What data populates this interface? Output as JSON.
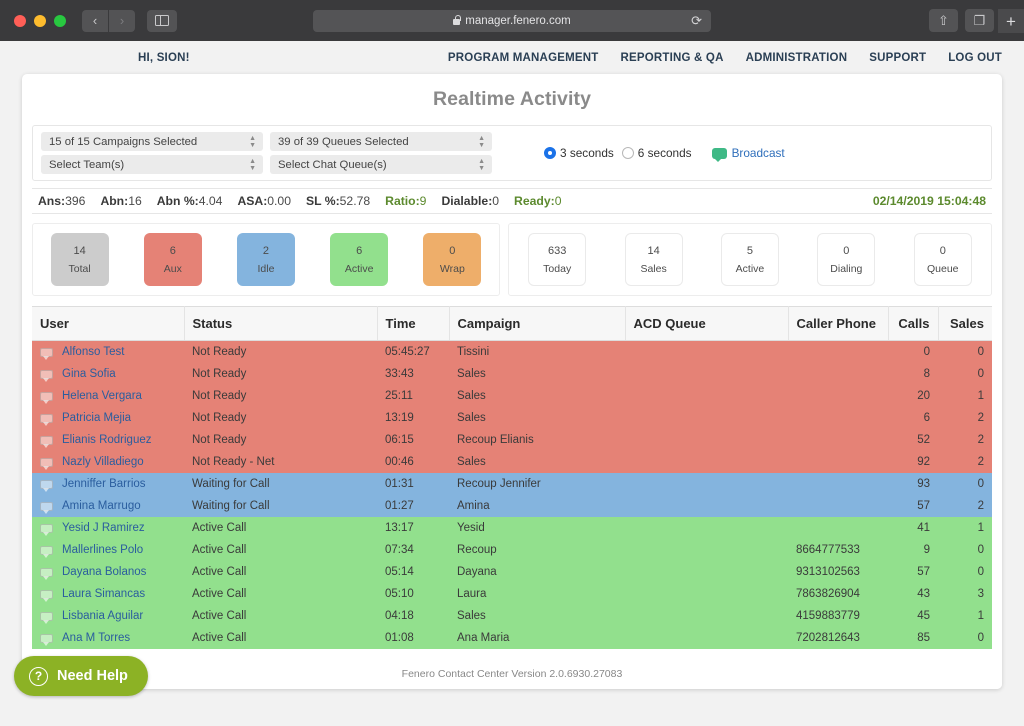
{
  "browser": {
    "url": "manager.fenero.com",
    "back_icon": "chevron-left-icon",
    "forward_icon": "chevron-right-icon",
    "sidebar_icon": "sidebar-toggle-icon",
    "reload_icon": "reload-icon",
    "share_icon": "share-icon",
    "tabs_icon": "show-tabs-icon",
    "new_tab_icon": "plus-icon"
  },
  "app_nav": {
    "greeting": "HI, SION!",
    "links": [
      "PROGRAM MANAGEMENT",
      "REPORTING & QA",
      "ADMINISTRATION",
      "SUPPORT",
      "LOG OUT"
    ]
  },
  "page": {
    "title": "Realtime Activity",
    "version": "Fenero Contact Center Version 2.0.6930.27083",
    "need_help": "Need Help"
  },
  "filters": {
    "campaigns": "15 of 15 Campaigns Selected",
    "queues": "39 of 39 Queues Selected",
    "teams": "Select Team(s)",
    "chat_queues": "Select Chat Queue(s)",
    "refresh": [
      {
        "label": "3 seconds",
        "selected": true
      },
      {
        "label": "6 seconds",
        "selected": false
      }
    ],
    "broadcast": "Broadcast"
  },
  "stats": [
    {
      "key": "Ans:",
      "value": "396",
      "green": false
    },
    {
      "key": "Abn:",
      "value": "16",
      "green": false
    },
    {
      "key": "Abn %:",
      "value": "4.04",
      "green": false
    },
    {
      "key": "ASA:",
      "value": "0.00",
      "green": false
    },
    {
      "key": "SL %:",
      "value": "52.78",
      "green": false
    },
    {
      "key": "Ratio:",
      "value": "9",
      "green": true
    },
    {
      "key": "Dialable:",
      "value": "0",
      "green": false
    },
    {
      "key": "Ready:",
      "value": "0",
      "green": true
    }
  ],
  "clock": "02/14/2019 15:04:48",
  "agent_tiles": [
    {
      "num": "14",
      "label": "Total",
      "color": "gray"
    },
    {
      "num": "6",
      "label": "Aux",
      "color": "red"
    },
    {
      "num": "2",
      "label": "Idle",
      "color": "blue"
    },
    {
      "num": "6",
      "label": "Active",
      "color": "green"
    },
    {
      "num": "0",
      "label": "Wrap",
      "color": "orange"
    }
  ],
  "call_tiles": [
    {
      "num": "633",
      "label": "Today",
      "color": "plain"
    },
    {
      "num": "14",
      "label": "Sales",
      "color": "plain"
    },
    {
      "num": "5",
      "label": "Active",
      "color": "plain"
    },
    {
      "num": "0",
      "label": "Dialing",
      "color": "plain"
    },
    {
      "num": "0",
      "label": "Queue",
      "color": "plain"
    }
  ],
  "table": {
    "columns": [
      "User",
      "Status",
      "Time",
      "Campaign",
      "ACD Queue",
      "Caller Phone",
      "Calls",
      "Sales"
    ],
    "rows": [
      {
        "state": "notready",
        "user": "Alfonso Test",
        "status": "Not Ready",
        "time": "05:45:27",
        "campaign": "Tissini",
        "acd_queue": "",
        "caller_phone": "",
        "calls": "0",
        "sales": "0"
      },
      {
        "state": "notready",
        "user": "Gina Sofia",
        "status": "Not Ready",
        "time": "33:43",
        "campaign": "Sales",
        "acd_queue": "",
        "caller_phone": "",
        "calls": "8",
        "sales": "0"
      },
      {
        "state": "notready",
        "user": "Helena Vergara",
        "status": "Not Ready",
        "time": "25:11",
        "campaign": "Sales",
        "acd_queue": "",
        "caller_phone": "",
        "calls": "20",
        "sales": "1"
      },
      {
        "state": "notready",
        "user": "Patricia Mejia",
        "status": "Not Ready",
        "time": "13:19",
        "campaign": "Sales",
        "acd_queue": "",
        "caller_phone": "",
        "calls": "6",
        "sales": "2"
      },
      {
        "state": "notready",
        "user": "Elianis Rodriguez",
        "status": "Not Ready",
        "time": "06:15",
        "campaign": "Recoup Elianis",
        "acd_queue": "",
        "caller_phone": "",
        "calls": "52",
        "sales": "2"
      },
      {
        "state": "notready",
        "user": "Nazly Villadiego",
        "status": "Not Ready - Net",
        "time": "00:46",
        "campaign": "Sales",
        "acd_queue": "",
        "caller_phone": "",
        "calls": "92",
        "sales": "2"
      },
      {
        "state": "waiting",
        "user": "Jenniffer Barrios",
        "status": "Waiting for Call",
        "time": "01:31",
        "campaign": "Recoup Jennifer",
        "acd_queue": "",
        "caller_phone": "",
        "calls": "93",
        "sales": "0"
      },
      {
        "state": "waiting",
        "user": "Amina Marrugo",
        "status": "Waiting for Call",
        "time": "01:27",
        "campaign": "Amina",
        "acd_queue": "",
        "caller_phone": "",
        "calls": "57",
        "sales": "2"
      },
      {
        "state": "active",
        "user": "Yesid J Ramirez",
        "status": "Active Call",
        "time": "13:17",
        "campaign": "Yesid",
        "acd_queue": "",
        "caller_phone": "",
        "calls": "41",
        "sales": "1"
      },
      {
        "state": "active",
        "user": "Mallerlines Polo",
        "status": "Active Call",
        "time": "07:34",
        "campaign": "Recoup",
        "acd_queue": "",
        "caller_phone": "8664777533",
        "calls": "9",
        "sales": "0"
      },
      {
        "state": "active",
        "user": "Dayana Bolanos",
        "status": "Active Call",
        "time": "05:14",
        "campaign": "Dayana",
        "acd_queue": "",
        "caller_phone": "9313102563",
        "calls": "57",
        "sales": "0"
      },
      {
        "state": "active",
        "user": "Laura Simancas",
        "status": "Active Call",
        "time": "05:10",
        "campaign": "Laura",
        "acd_queue": "",
        "caller_phone": "7863826904",
        "calls": "43",
        "sales": "3"
      },
      {
        "state": "active",
        "user": "Lisbania Aguilar",
        "status": "Active Call",
        "time": "04:18",
        "campaign": "Sales",
        "acd_queue": "",
        "caller_phone": "4159883779",
        "calls": "45",
        "sales": "1"
      },
      {
        "state": "active",
        "user": "Ana M Torres",
        "status": "Active Call",
        "time": "01:08",
        "campaign": "Ana Maria",
        "acd_queue": "",
        "caller_phone": "7202812643",
        "calls": "85",
        "sales": "0"
      }
    ]
  },
  "colors": {
    "not_ready": "#e58276",
    "waiting": "#84b4de",
    "active": "#92e08d",
    "wrap": "#eeae6a",
    "total": "#cccccc",
    "accent_green": "#5c8a2e",
    "help_green": "#8cb225",
    "link_blue": "#2a5d9e"
  }
}
